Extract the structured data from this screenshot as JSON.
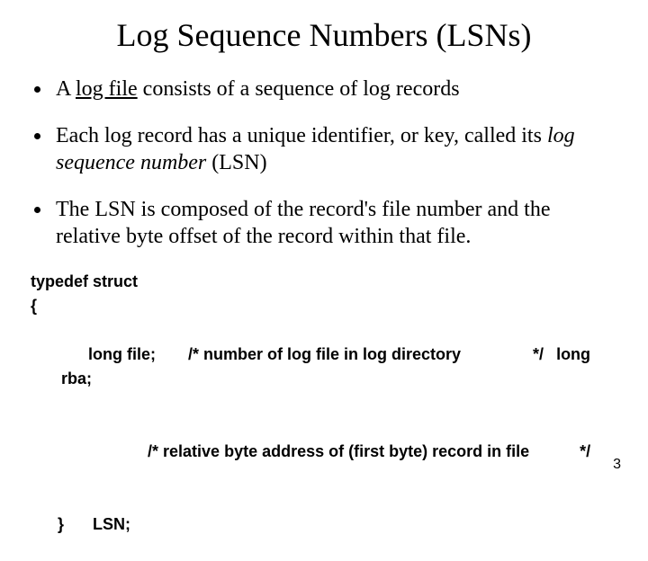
{
  "title": "Log Sequence Numbers (LSNs)",
  "bullets": {
    "b1_pre": "A ",
    "b1_u": "log file",
    "b1_post": " consists of a sequence of log records",
    "b2_pre": "Each log record has a unique identifier, or key, called its ",
    "b2_i": "log sequence number",
    "b2_post": " (LSN)",
    "b3": "The LSN is composed of the record's file number and the relative byte offset of the record within that file."
  },
  "code": {
    "l1": "typedef struct",
    "l2": "{",
    "l3_a": "long file;",
    "l3_b": "/* number of log file in log directory",
    "l3_c": "*/",
    "l3_d1": "long",
    "l3_d2": "rba;",
    "l4_a": "/* relative byte address of (first byte) record in file",
    "l4_b": "*/",
    "l5_a": "}",
    "l5_b": "LSN;"
  },
  "pagenum": "3"
}
